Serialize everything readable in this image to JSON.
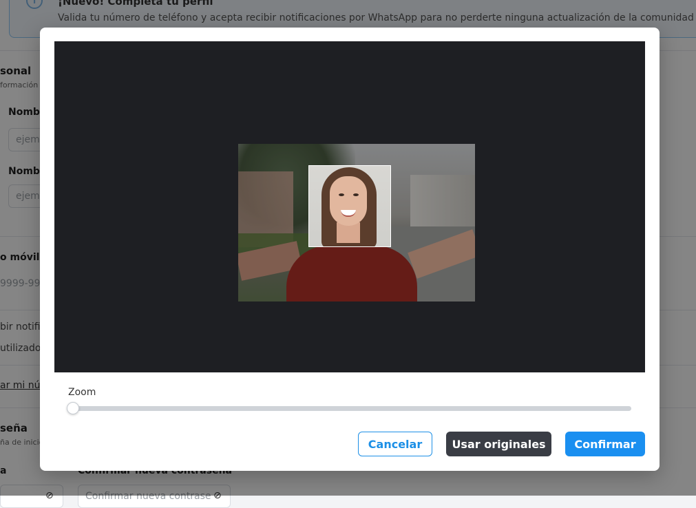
{
  "background": {
    "banner": {
      "title": "¡Nuevo! Completa tu perfil",
      "text": "Valida tu número de teléfono y acepta recibir notificaciones por WhatsApp para no perderte ninguna actualización de la comunidad"
    },
    "personal_section": {
      "title": "sonal",
      "subtitle": "formación"
    },
    "name_label": "Nombr",
    "name_placeholder": "ejem",
    "surname_label": "Nombr",
    "surname_placeholder": "ejem",
    "mobile_label": "o móvil",
    "mobile_placeholder": "9999-999",
    "notif_line1": "bir notific",
    "notif_line2": "utilizado",
    "verify_link": "ar mi núm",
    "password_section": {
      "title": "seña",
      "subtitle": "ña de inicio"
    },
    "new_pass_label": "a",
    "confirm_pass_label": "Confirmar nueva contraseña",
    "confirm_pass_placeholder": "Confirmar nueva contrase"
  },
  "modal": {
    "zoom_label": "Zoom",
    "zoom_value": 0,
    "buttons": {
      "cancel": "Cancelar",
      "use_original": "Usar originales",
      "confirm": "Confirmar"
    },
    "colors": {
      "primary": "#1a8ff0",
      "dark": "#3a3d45",
      "crop_background": "#1e1f23"
    }
  }
}
